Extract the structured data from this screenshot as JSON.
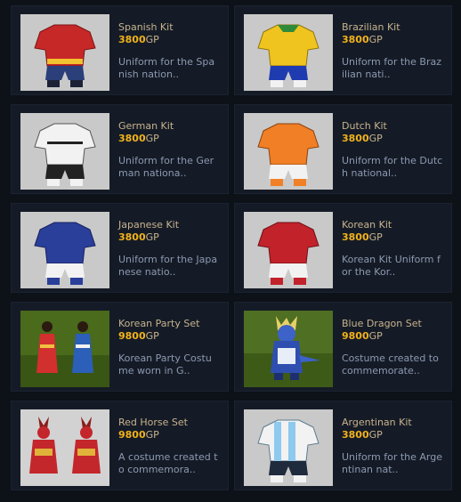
{
  "currency": "GP",
  "items": [
    {
      "name": "Spanish Kit",
      "price": "3800",
      "description": "Uniform for the Spa\nnish nation..",
      "thumb": "spanish-kit-icon",
      "kit_colors": {
        "shirt": "#c62828",
        "trim": "#f2c230",
        "shorts": "#2b3f7a",
        "socks": "#1b2236"
      }
    },
    {
      "name": "Brazilian Kit",
      "price": "3800",
      "description": "Uniform for the Braz\nilian nati..",
      "thumb": "brazilian-kit-icon",
      "kit_colors": {
        "shirt": "#f0c41f",
        "trim": "#2e8b3a",
        "shorts": "#1f3bb0",
        "socks": "#f2f2f2"
      }
    },
    {
      "name": "German Kit",
      "price": "3800",
      "description": "Uniform for the Ger\nman nationa..",
      "thumb": "german-kit-icon",
      "kit_colors": {
        "shirt": "#f2f2f2",
        "trim": "#222222",
        "shorts": "#222222",
        "socks": "#f2f2f2"
      }
    },
    {
      "name": "Dutch Kit",
      "price": "3800",
      "description": "Uniform for the Dutc\nh national..",
      "thumb": "dutch-kit-icon",
      "kit_colors": {
        "shirt": "#f07f25",
        "trim": "#ffffff",
        "shorts": "#f2f2f2",
        "socks": "#f07f25"
      }
    },
    {
      "name": "Japanese Kit",
      "price": "3800",
      "description": "Uniform for the Japa\nnese natio..",
      "thumb": "japanese-kit-icon",
      "kit_colors": {
        "shirt": "#2a3f9a",
        "trim": "#d9d9d9",
        "shorts": "#f2f2f2",
        "socks": "#2a3f9a"
      }
    },
    {
      "name": "Korean Kit",
      "price": "3800",
      "description": "Korean Kit Uniform f\nor the Kor..",
      "thumb": "korean-kit-icon",
      "kit_colors": {
        "shirt": "#c2222a",
        "trim": "#ffffff",
        "shorts": "#f2f2f2",
        "socks": "#c2222a"
      }
    },
    {
      "name": "Korean Party Set",
      "price": "9800",
      "description": "Korean Party Costu\nme worn in G..",
      "thumb": "korean-party-set-icon"
    },
    {
      "name": "Blue Dragon Set",
      "price": "9800",
      "description": "Costume created to\ncommemorate..",
      "thumb": "blue-dragon-set-icon"
    },
    {
      "name": "Red Horse Set",
      "price": "9800",
      "description": "A costume created t\no commemora..",
      "thumb": "red-horse-set-icon"
    },
    {
      "name": "Argentinan Kit",
      "price": "3800",
      "description": "Uniform for the Arge\nntinan nat..",
      "thumb": "argentinan-kit-icon",
      "kit_colors": {
        "shirt": "#8ec9ee",
        "trim": "#ffffff",
        "shorts": "#1f2a3d",
        "socks": "#f2f2f2"
      }
    }
  ]
}
